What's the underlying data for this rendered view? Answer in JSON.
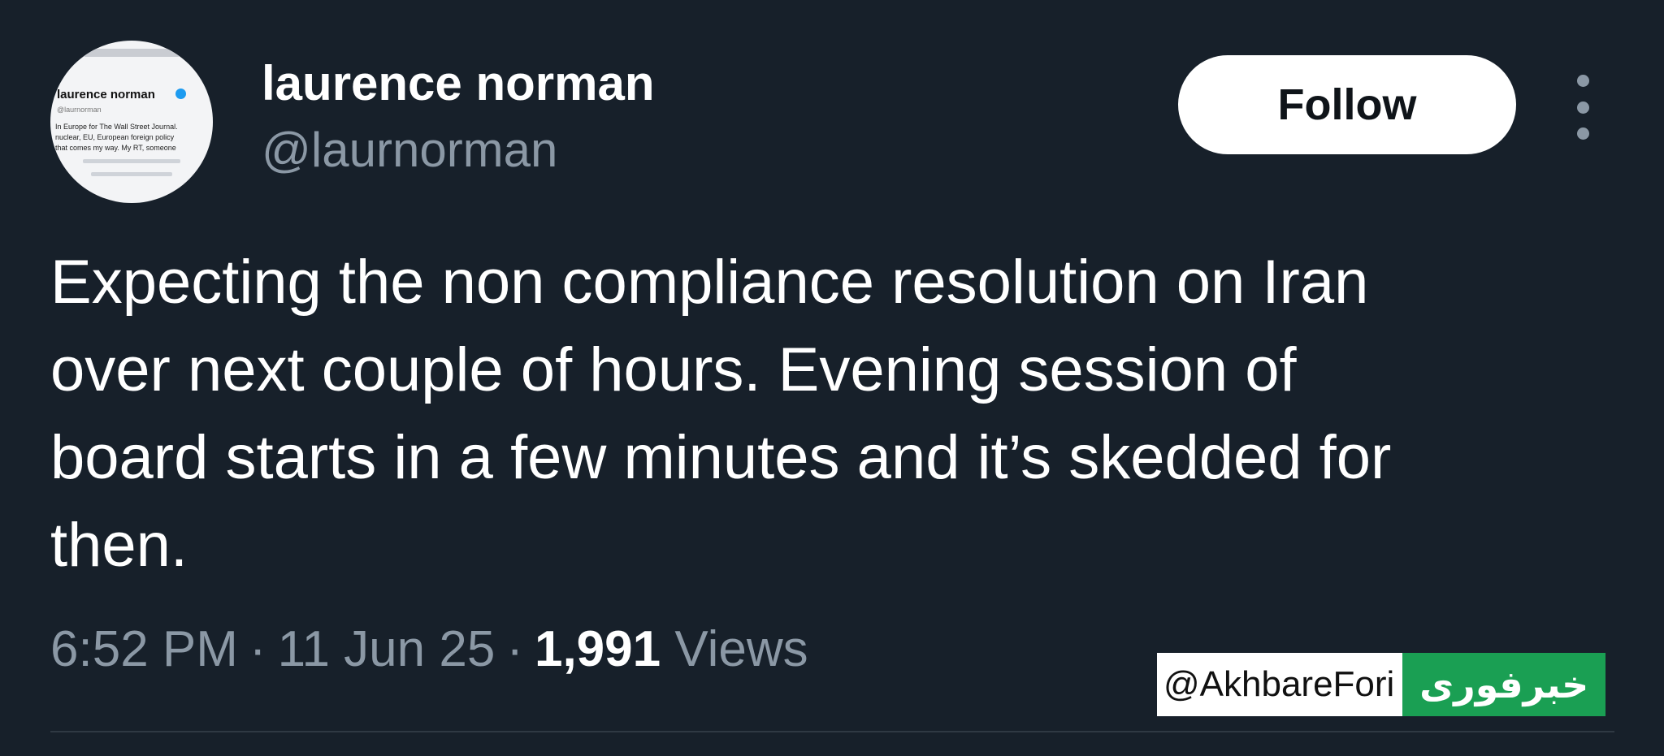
{
  "author": {
    "display_name": "laurence norman",
    "handle": "@laurnorman",
    "avatar_snapshot": {
      "name": "laurence norman",
      "handle": "@laurnorman",
      "bio": "In Europe for The Wall Street Journal.\nnuclear, EU, European foreign policy\nthat comes my way. My RT, someone"
    }
  },
  "actions": {
    "follow_label": "Follow",
    "more_icon": "more-vertical-icon"
  },
  "tweet": {
    "text": "Expecting the non compliance resolution on Iran\nover next couple of hours. Evening session of\nboard starts in a few minutes and it’s skedded for\nthen.",
    "time": "6:52 PM",
    "separator": "·",
    "date": "11 Jun 25",
    "views_count": "1,991",
    "views_label": "Views"
  },
  "watermark": {
    "handle": "@AkhbareFori",
    "logo_text": "خبرفوری"
  },
  "colors": {
    "background": "#17202a",
    "text_primary": "#ffffff",
    "text_secondary": "#8b98a5",
    "follow_button_bg": "#ffffff",
    "watermark_green": "#1a9f53"
  }
}
